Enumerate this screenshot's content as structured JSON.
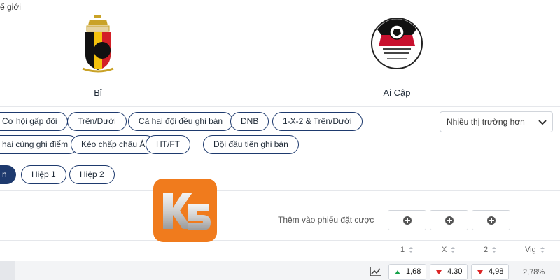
{
  "header": {
    "breadcrumb_fragment": "ế giới",
    "home_team": {
      "name": "Bỉ",
      "crest_icon": "belgium-crest-icon"
    },
    "away_team": {
      "name": "Ai Cập",
      "crest_icon": "egypt-crest-icon"
    }
  },
  "markets": {
    "row1": [
      "Cơ hội gấp đôi",
      "Trên/Dưới",
      "Cả hai đội đều ghi bàn",
      "DNB",
      "1-X-2 & Trên/Dưới"
    ],
    "row2": [
      "hai cùng ghi điểm",
      "Kèo chấp châu Á",
      "HT/FT",
      "Đội đầu tiên ghi bàn"
    ],
    "periods": [
      "n",
      "Hiệp 1",
      "Hiệp 2"
    ],
    "more_markets_select": "Nhiều thị trường hơn"
  },
  "betslip": {
    "label": "Thêm vào phiếu đặt cược"
  },
  "odds_table": {
    "columns": [
      "1",
      "X",
      "2",
      "Vig"
    ],
    "row": {
      "home": {
        "value": "1,68",
        "trend": "up"
      },
      "draw": {
        "value": "4.30",
        "trend": "down"
      },
      "away": {
        "value": "4,98",
        "trend": "down"
      },
      "vig": "2,78%"
    }
  },
  "logo": {
    "text": "K5",
    "color": "#f07b1d"
  },
  "colors": {
    "accent": "#1e3a6e",
    "up": "#16a34a",
    "down": "#dc2626"
  }
}
